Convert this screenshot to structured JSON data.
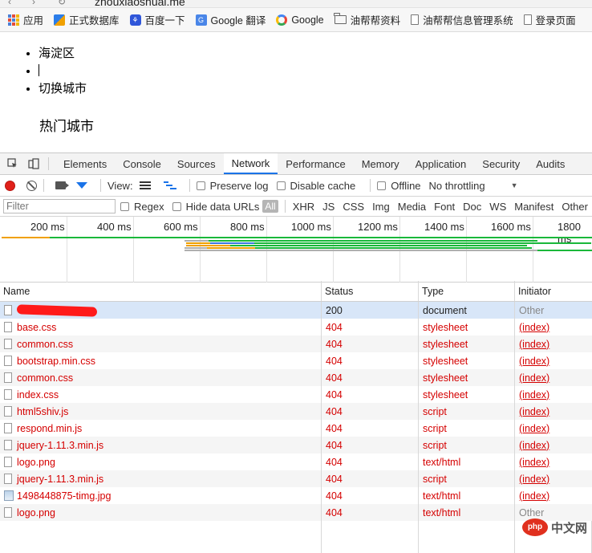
{
  "browser": {
    "url_partial": "zhouxiaoshuai.me",
    "bookmarks": [
      {
        "label": "应用",
        "icon": "apps-grid-icon"
      },
      {
        "label": "正式数据库",
        "icon": "phpmyadmin-icon"
      },
      {
        "label": "百度一下",
        "icon": "baidu-icon"
      },
      {
        "label": "Google 翻译",
        "icon": "google-translate-icon"
      },
      {
        "label": "Google",
        "icon": "google-icon"
      },
      {
        "label": "油帮帮资料",
        "icon": "folder-icon"
      },
      {
        "label": "油帮帮信息管理系统",
        "icon": "page-icon"
      },
      {
        "label": "登录页面",
        "icon": "page-icon"
      }
    ]
  },
  "page": {
    "list_items": [
      "海淀区",
      "",
      "切换城市"
    ],
    "hot_cities_title": "热门城市"
  },
  "devtools": {
    "tabs": [
      "Elements",
      "Console",
      "Sources",
      "Network",
      "Performance",
      "Memory",
      "Application",
      "Security",
      "Audits"
    ],
    "active_tab": "Network",
    "toolbar": {
      "view_label": "View:",
      "preserve_log": "Preserve log",
      "disable_cache": "Disable cache",
      "offline": "Offline",
      "throttling": "No throttling"
    },
    "filterbar": {
      "filter_placeholder": "Filter",
      "regex": "Regex",
      "hide_data_urls": "Hide data URLs",
      "all": "All",
      "types": [
        "XHR",
        "JS",
        "CSS",
        "Img",
        "Media",
        "Font",
        "Doc",
        "WS",
        "Manifest",
        "Other"
      ]
    },
    "overview": {
      "ticks": [
        "200 ms",
        "400 ms",
        "600 ms",
        "800 ms",
        "1000 ms",
        "1200 ms",
        "1400 ms",
        "1600 ms",
        "1800 ms"
      ],
      "colors": {
        "waiting": "#f0a000",
        "loading": "#1ab83a",
        "queue": "#b0b0b0",
        "blue": "#3a78e0"
      }
    },
    "table": {
      "headers": {
        "name": "Name",
        "status": "Status",
        "type": "Type",
        "initiator": "Initiator"
      },
      "rows": [
        {
          "name": "",
          "status": "200",
          "type": "document",
          "initiator": "Other",
          "error": false,
          "redacted": true,
          "icon": "document-icon"
        },
        {
          "name": "base.css",
          "status": "404",
          "type": "stylesheet",
          "initiator": "(index)",
          "error": true,
          "icon": "file-icon"
        },
        {
          "name": "common.css",
          "status": "404",
          "type": "stylesheet",
          "initiator": "(index)",
          "error": true,
          "icon": "file-icon"
        },
        {
          "name": "bootstrap.min.css",
          "status": "404",
          "type": "stylesheet",
          "initiator": "(index)",
          "error": true,
          "icon": "file-icon"
        },
        {
          "name": "common.css",
          "status": "404",
          "type": "stylesheet",
          "initiator": "(index)",
          "error": true,
          "icon": "file-icon"
        },
        {
          "name": "index.css",
          "status": "404",
          "type": "stylesheet",
          "initiator": "(index)",
          "error": true,
          "icon": "file-icon"
        },
        {
          "name": "html5shiv.js",
          "status": "404",
          "type": "script",
          "initiator": "(index)",
          "error": true,
          "icon": "file-icon"
        },
        {
          "name": "respond.min.js",
          "status": "404",
          "type": "script",
          "initiator": "(index)",
          "error": true,
          "icon": "file-icon"
        },
        {
          "name": "jquery-1.11.3.min.js",
          "status": "404",
          "type": "script",
          "initiator": "(index)",
          "error": true,
          "icon": "file-icon"
        },
        {
          "name": "logo.png",
          "status": "404",
          "type": "text/html",
          "initiator": "(index)",
          "error": true,
          "icon": "file-icon"
        },
        {
          "name": "jquery-1.11.3.min.js",
          "status": "404",
          "type": "script",
          "initiator": "(index)",
          "error": true,
          "icon": "file-icon"
        },
        {
          "name": "1498448875-timg.jpg",
          "status": "404",
          "type": "text/html",
          "initiator": "(index)",
          "error": true,
          "icon": "image-icon"
        },
        {
          "name": "logo.png",
          "status": "404",
          "type": "text/html",
          "initiator": "Other",
          "error": true,
          "icon": "file-icon"
        }
      ]
    }
  },
  "watermark": {
    "logo_text": "php",
    "site": "中文网"
  }
}
